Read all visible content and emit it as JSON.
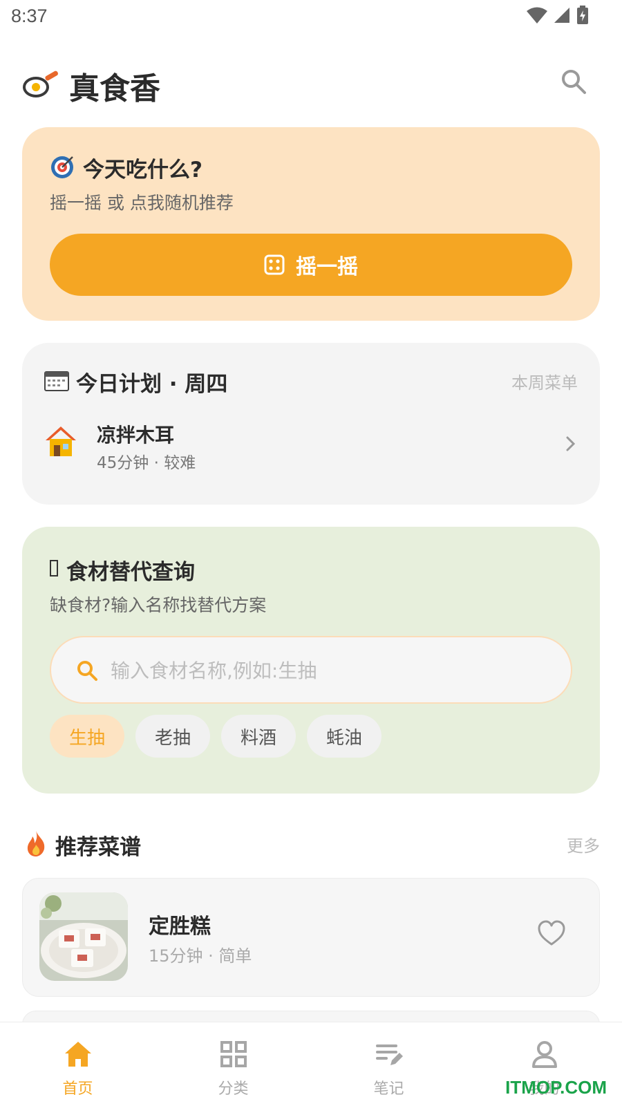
{
  "status_bar": {
    "time": "8:37"
  },
  "header": {
    "app_title": "真食香"
  },
  "shake": {
    "title": "今天吃什么?",
    "subtitle": "摇一摇 或 点我随机推荐",
    "button_label": "摇一摇"
  },
  "plan": {
    "title": "今日计划 · 周四",
    "link": "本周菜单",
    "item": {
      "name": "凉拌木耳",
      "meta": "45分钟 · 较难"
    }
  },
  "substitute": {
    "title": "食材替代查询",
    "subtitle": "缺食材?输入名称找替代方案",
    "search_placeholder": "输入食材名称,例如:生抽",
    "chips": [
      "生抽",
      "老抽",
      "料酒",
      "蚝油"
    ]
  },
  "recommend": {
    "title": "推荐菜谱",
    "more": "更多",
    "recipes": [
      {
        "name": "定胜糕",
        "meta": "15分钟 · 简单"
      }
    ]
  },
  "tabs": [
    {
      "label": "首页",
      "icon": "home-icon",
      "active": true
    },
    {
      "label": "分类",
      "icon": "grid-icon",
      "active": false
    },
    {
      "label": "笔记",
      "icon": "notes-icon",
      "active": false
    },
    {
      "label": "我的",
      "icon": "user-icon",
      "active": false
    }
  ],
  "watermark": "ITMOP.COM",
  "colors": {
    "accent": "#f5a623",
    "shake_bg": "#fde3c2",
    "substitute_bg": "#e7efdc",
    "plan_bg": "#f4f4f4"
  }
}
